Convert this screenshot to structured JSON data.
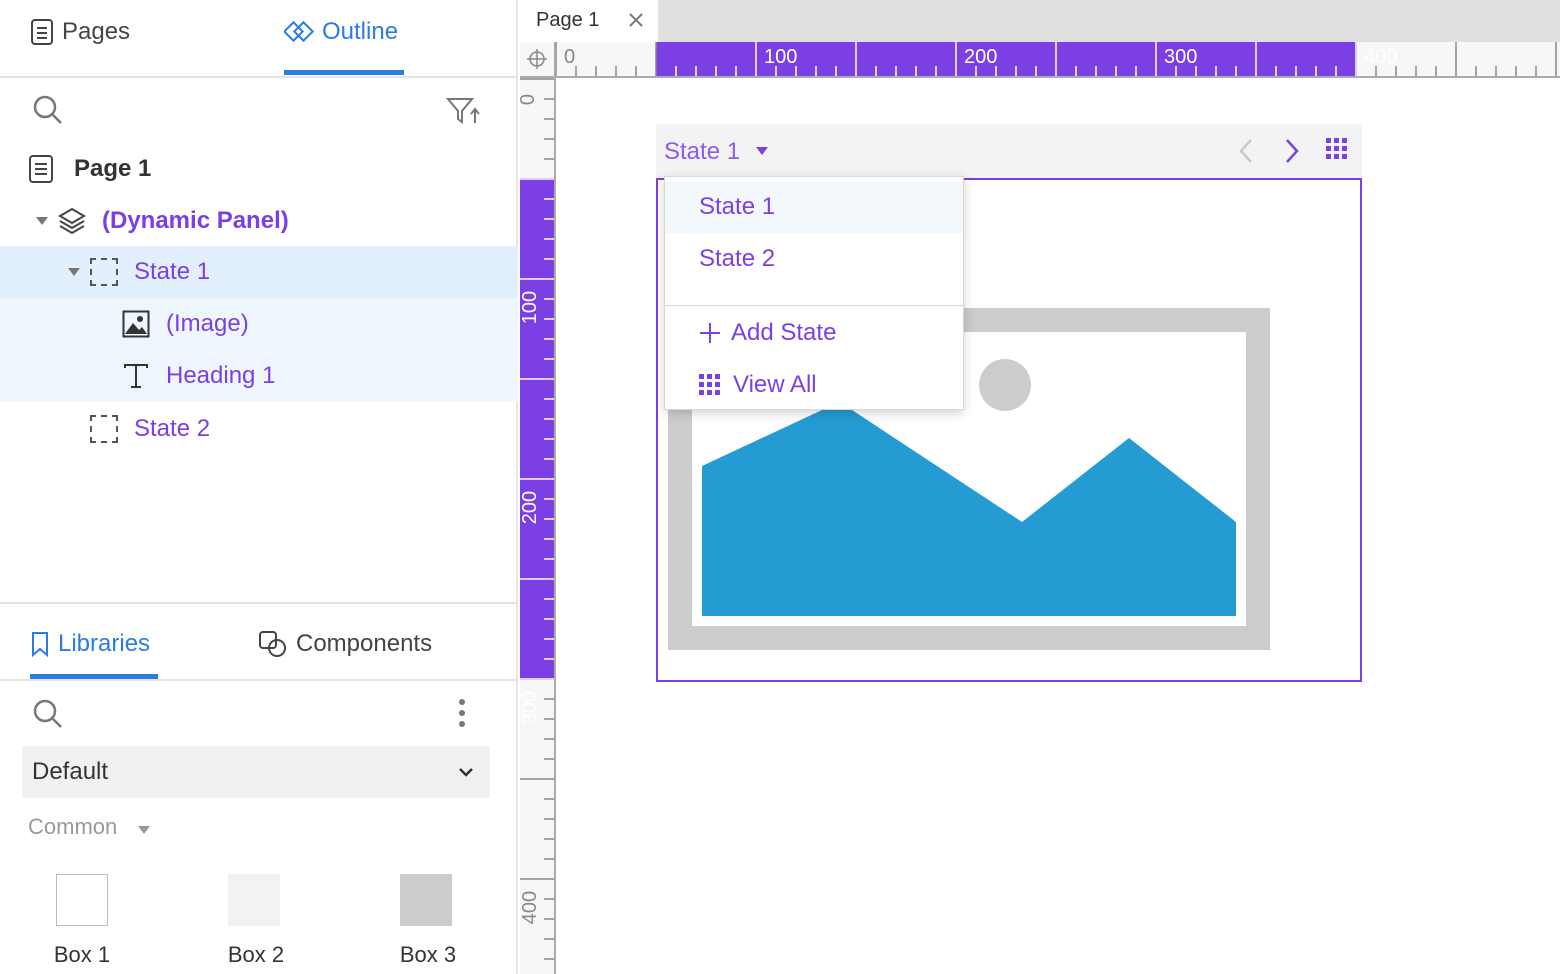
{
  "left_panel": {
    "tabs": {
      "pages": "Pages",
      "outline": "Outline"
    },
    "tree": {
      "page": "Page 1",
      "dynamic_panel": "(Dynamic Panel)",
      "state1": "State 1",
      "image": "(Image)",
      "heading": "Heading 1",
      "state2": "State 2"
    },
    "bottom_tabs": {
      "libraries": "Libraries",
      "components": "Components"
    },
    "library_select": "Default",
    "category": "Common",
    "items": [
      "Box 1",
      "Box 2",
      "Box 3"
    ]
  },
  "document_tab": {
    "label": "Page 1"
  },
  "rulers": {
    "top": [
      "0",
      "100",
      "200",
      "300",
      "400"
    ],
    "left": [
      "0",
      "100",
      "200",
      "300",
      "400"
    ]
  },
  "dynamic_panel": {
    "current_state": "State 1",
    "menu": {
      "states": [
        "State 1",
        "State 2"
      ],
      "add_state": "Add State",
      "view_all": "View All"
    }
  },
  "colors": {
    "accent_purple": "#7b3fe4",
    "accent_blue": "#2a7be4",
    "selection_bg": "#e1f0fc",
    "selection_bg_light": "#eef7fd",
    "image_blue": "#259bd3",
    "placeholder_gray": "#cccccc"
  }
}
